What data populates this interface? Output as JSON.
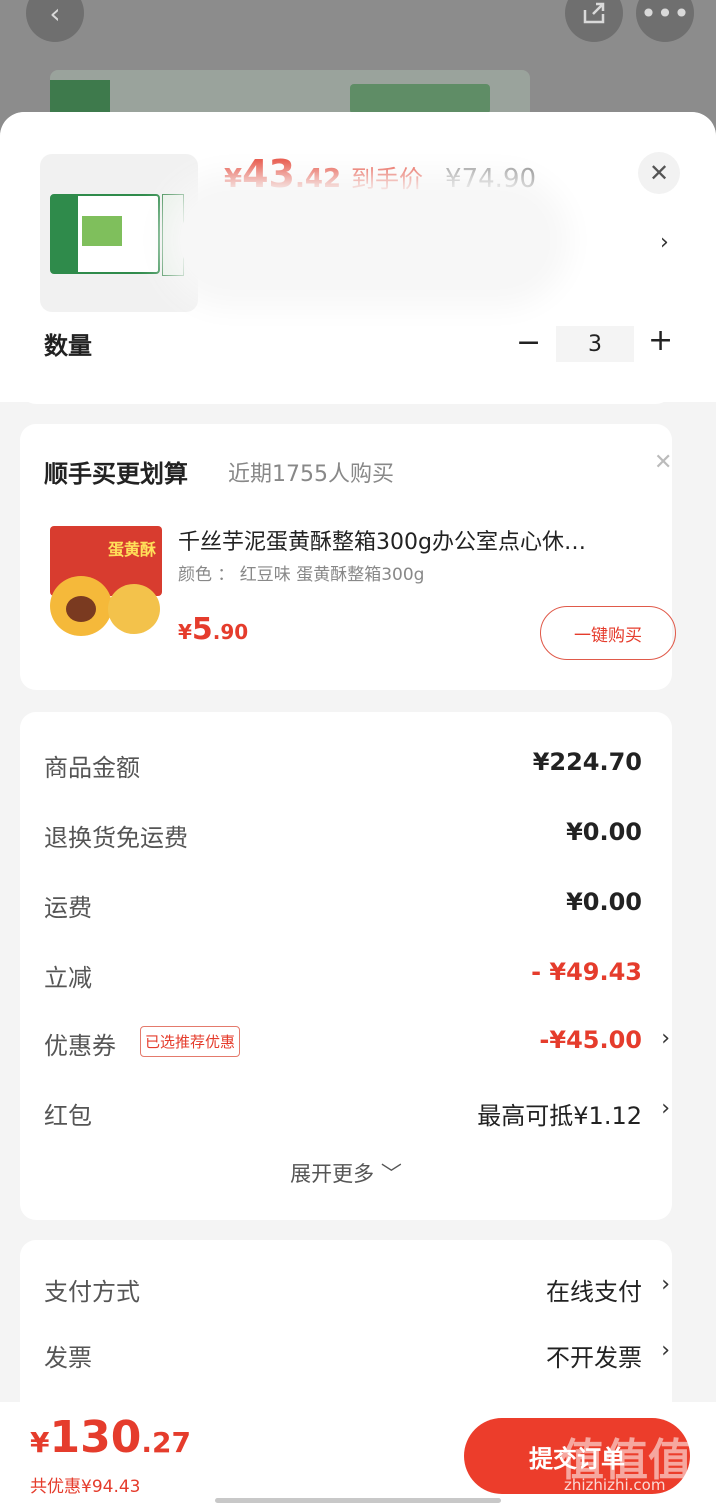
{
  "background_page": {
    "more_badge": ""
  },
  "product": {
    "price_yen": "¥",
    "price_int": "43",
    "price_dec": ".42",
    "price_tag": "到手价",
    "original_price": "¥74.90"
  },
  "quantity": {
    "label": "数量",
    "minus": "−",
    "value": "3",
    "plus": "+"
  },
  "upsell": {
    "title": "顺手买更划算",
    "subtitle": "近期1755人购买",
    "box_text": "蛋黄酥",
    "item_name": "千丝芋泥蛋黄酥整箱300g办公室点心休…",
    "item_variant": "颜色 ： 红豆味  蛋黄酥整箱300g",
    "price_yen": "¥",
    "price_int": "5",
    "price_dec": ".90",
    "buy_label": "一键购买"
  },
  "summary": {
    "rows": [
      {
        "label": "商品金额",
        "value": "¥224.70"
      },
      {
        "label": "退换货免运费",
        "value": "¥0.00"
      },
      {
        "label": "运费",
        "value": "¥0.00"
      },
      {
        "label": "立减",
        "value": "- ¥49.43"
      },
      {
        "label": "优惠券",
        "value": "-¥45.00",
        "badge": "已选推荐优惠"
      },
      {
        "label": "红包",
        "value": "最高可抵¥1.12"
      }
    ],
    "expand_label": "展开更多 ﹀"
  },
  "payment": {
    "rows": [
      {
        "label": "支付方式",
        "value": "在线支付"
      },
      {
        "label": "发票",
        "value": "不开发票"
      }
    ]
  },
  "bottom": {
    "total_yen": "¥",
    "total_int": "130",
    "total_dec": ".27",
    "saved": "共优惠¥94.43",
    "submit_label": "提交订单",
    "watermark": "值值值",
    "watermark_url": "zhizhizhi.com"
  },
  "colors": {
    "accent": "#e53c2c",
    "submit": "#ec3d2b",
    "background": "#f4f4f4"
  }
}
